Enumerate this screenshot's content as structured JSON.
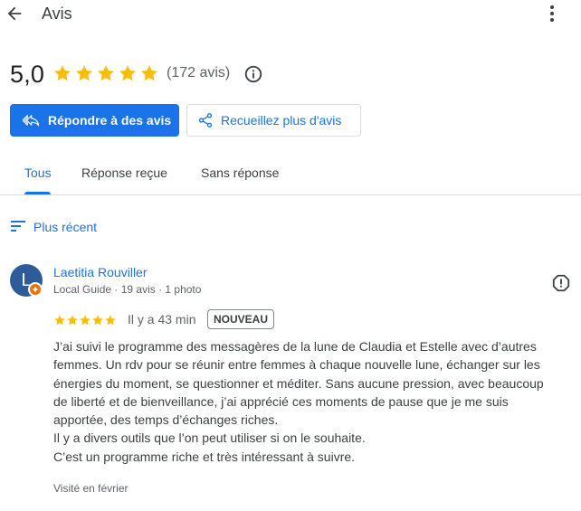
{
  "header": {
    "title": "Avis",
    "back_icon": "arrow-left-icon",
    "menu_icon": "more-vert-icon"
  },
  "summary": {
    "rating": "5,0",
    "stars": 5,
    "count_text": "(172 avis)",
    "info_icon": "info-icon"
  },
  "actions": {
    "reply_label": "Répondre à des avis",
    "collect_label": "Recueillez plus d'avis"
  },
  "tabs": [
    {
      "label": "Tous",
      "active": true
    },
    {
      "label": "Réponse reçue",
      "active": false
    },
    {
      "label": "Sans réponse",
      "active": false
    }
  ],
  "sort": {
    "label": "Plus récent"
  },
  "review": {
    "avatar_letter": "L",
    "name": "Laetitia Rouviller",
    "meta": "Local Guide · 19 avis · 1 photo",
    "stars": 5,
    "time": "Il y a 43 min",
    "badge": "NOUVEAU",
    "text": "J’ai suivi le programme des messagères de la lune de Claudia et Estelle avec d’autres femmes. Un rdv pour se réunir entre femmes à chaque nouvelle lune, échanger sur les énergies du moment, se questionner et méditer. Sans aucune pression, avec beaucoup de liberté et de bienveillance, j’ai apprécié ces moments de pause que je me suis apportée, des temps d’échanges riches.\nIl y a divers outils que l’on peut utiliser si on le souhaite.\nC’est un programme riche et très intéressant à suivre.",
    "visited": "Visité en février"
  },
  "colors": {
    "accent": "#1a73e8",
    "star": "#fbbc04",
    "avatar": "#2e5c9a",
    "guide_badge": "#e8710a"
  }
}
